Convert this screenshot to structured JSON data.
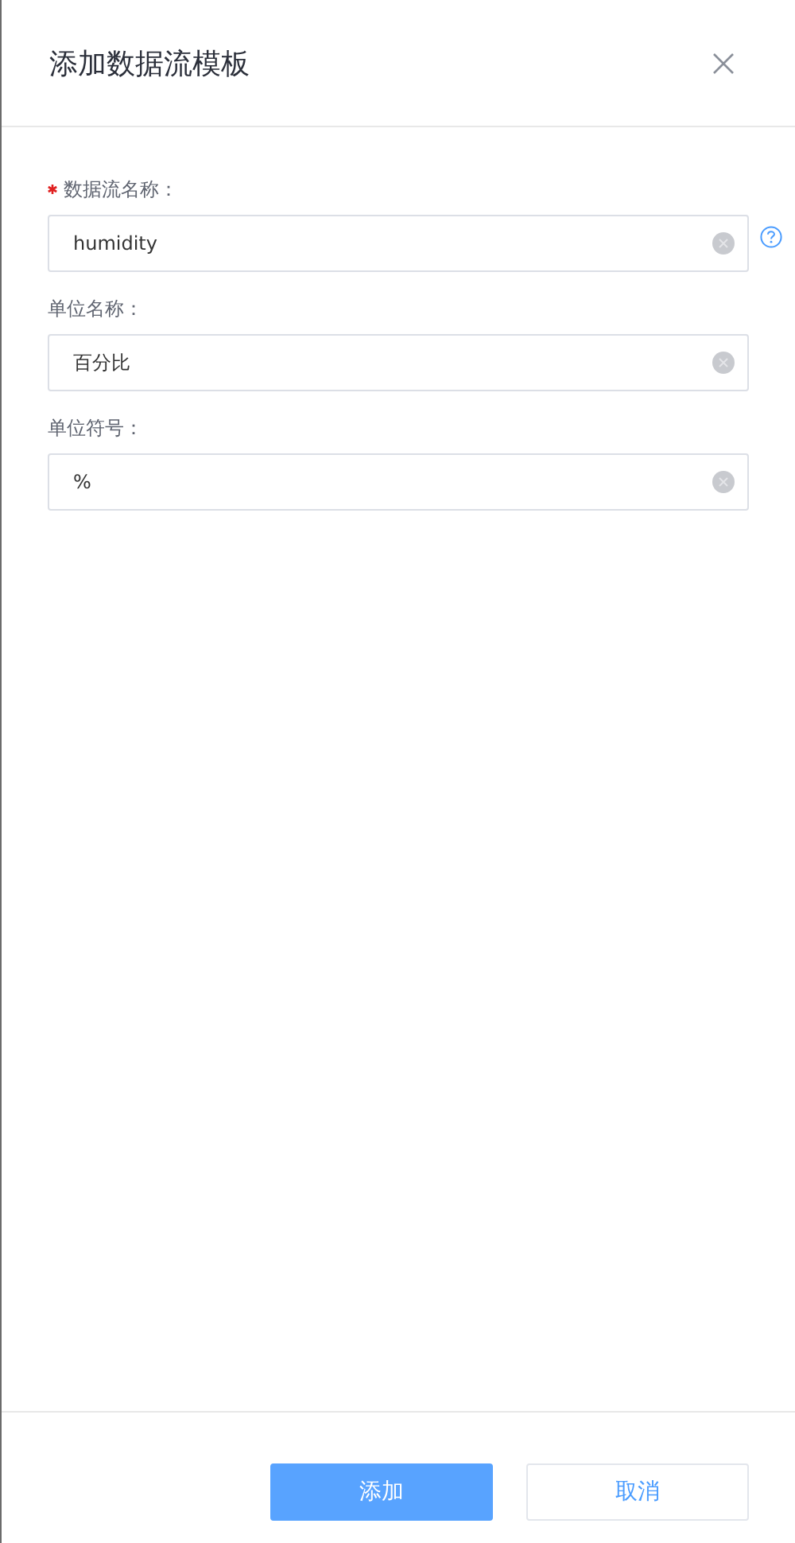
{
  "dialog": {
    "title": "添加数据流模板"
  },
  "fields": [
    {
      "label": "数据流名称：",
      "value": "humidity",
      "required": true,
      "help": true
    },
    {
      "label": "单位名称：",
      "value": "百分比",
      "required": false,
      "help": false
    },
    {
      "label": "单位符号：",
      "value": "%",
      "required": false,
      "help": false
    }
  ],
  "buttons": [
    {
      "label": "添加",
      "kind": "primary"
    },
    {
      "label": "取消",
      "kind": "secondary"
    }
  ]
}
